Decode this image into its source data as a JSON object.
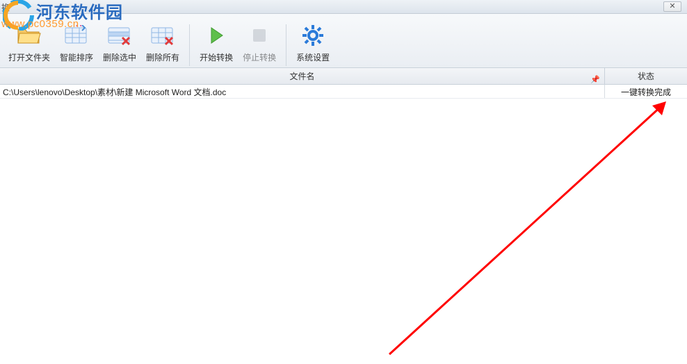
{
  "titlebar": {
    "fragment": "换"
  },
  "toolbar": {
    "open_folder": "打开文件夹",
    "smart_sort": "智能排序",
    "delete_selected": "删除选中",
    "delete_all": "删除所有",
    "start_convert": "开始转换",
    "stop_convert": "停止转换",
    "settings": "系统设置"
  },
  "grid": {
    "col_filename": "文件名",
    "col_status": "状态",
    "rows": [
      {
        "file": "C:\\Users\\lenovo\\Desktop\\素材\\新建 Microsoft Word 文档.doc",
        "status": "一键转换完成"
      }
    ]
  },
  "watermark": {
    "site_name": "河东软件园",
    "site_url": "www.pc0359.cn"
  }
}
